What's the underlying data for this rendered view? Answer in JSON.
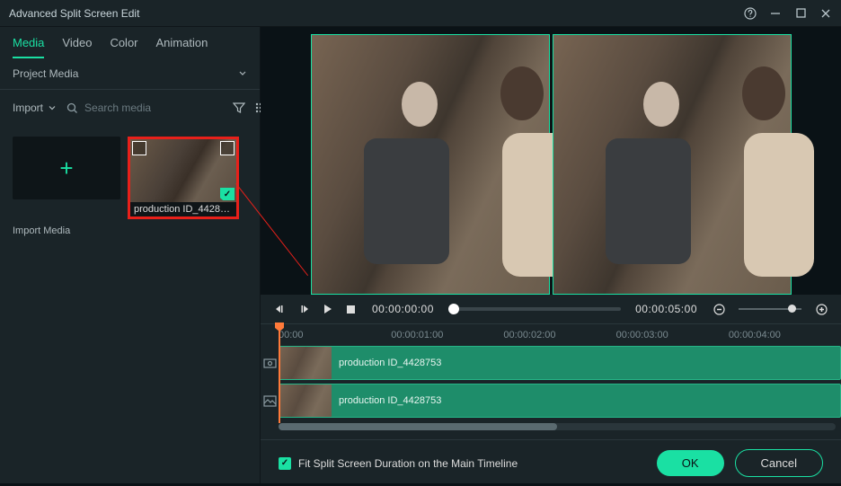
{
  "window": {
    "title": "Advanced Split Screen Edit"
  },
  "tabs": [
    "Media",
    "Video",
    "Color",
    "Animation"
  ],
  "active_tab": 0,
  "subheader": "Project Media",
  "import_button": "Import",
  "search_placeholder": "Search media",
  "import_tile_label": "Import Media",
  "clip": {
    "name": "production ID_4428753"
  },
  "transport": {
    "current": "00:00:00:00",
    "duration": "00:00:05:00"
  },
  "ruler_ticks": [
    "00:00",
    "00:00:01:00",
    "00:00:02:00",
    "00:00:03:00",
    "00:00:04:00"
  ],
  "timeline_clips": [
    "production ID_4428753",
    "production ID_4428753"
  ],
  "footer": {
    "checkbox_label": "Fit Split Screen Duration on the Main Timeline",
    "ok": "OK",
    "cancel": "Cancel"
  }
}
